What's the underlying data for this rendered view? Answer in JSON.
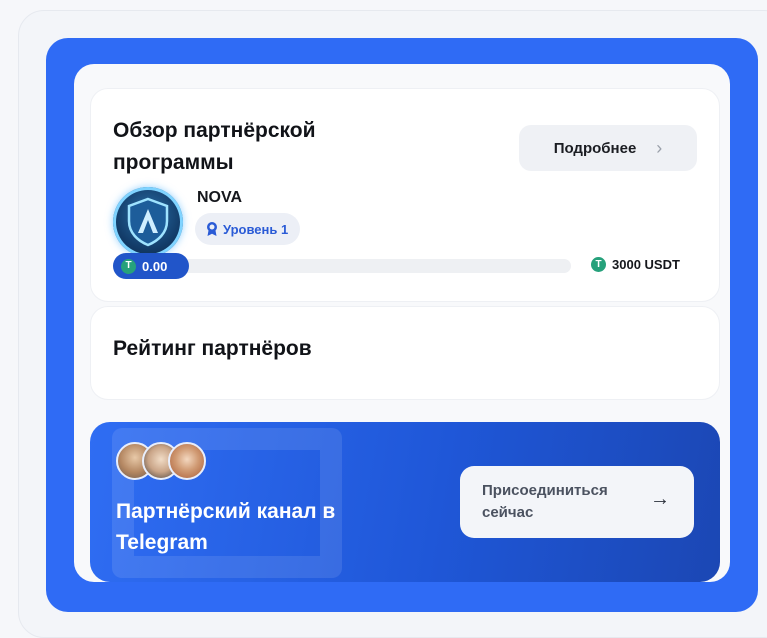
{
  "overview": {
    "title": "Обзор партнёрской программы",
    "more_button_label": "Подробнее",
    "partner_name": "NOVA",
    "level_label": "Уровень 1",
    "progress_current": "0.00",
    "progress_target": "3000 USDT",
    "progress_fraction": 0.0
  },
  "rating": {
    "title": "Рейтинг партнёров"
  },
  "telegram": {
    "title": "Партнёрский канал в Telegram",
    "join_button_label": "Присоединиться сейчас"
  },
  "icons": {
    "tether": "T",
    "chevron": "›",
    "arrow": "→"
  },
  "colors": {
    "accent_blue": "#2f6bf5",
    "tether_green": "#26a17b",
    "level_text": "#2a5bd6"
  }
}
